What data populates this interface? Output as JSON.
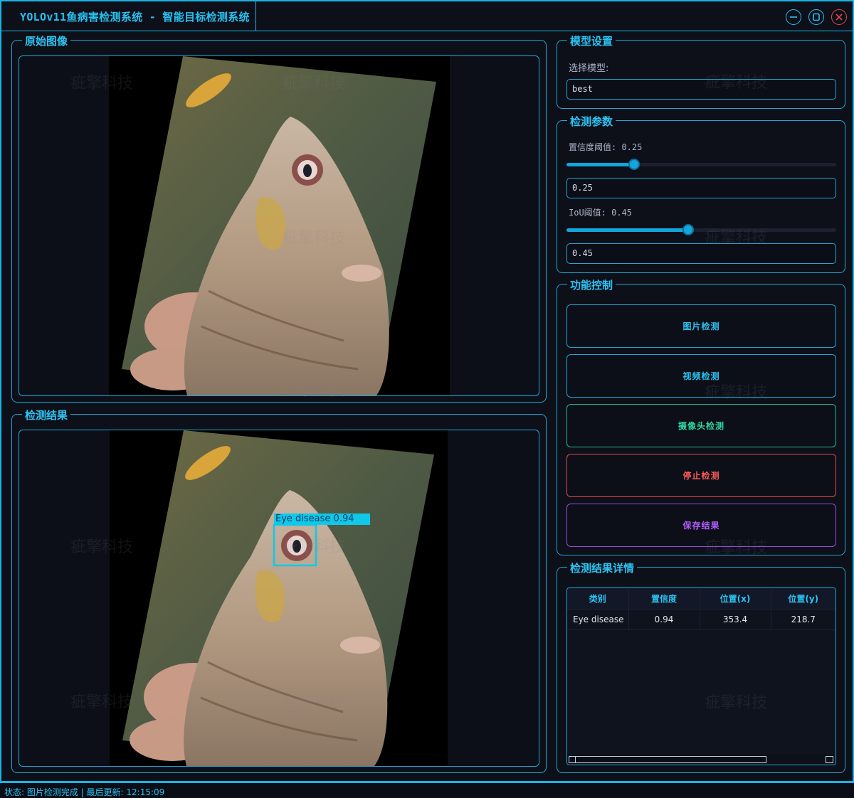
{
  "window": {
    "title": "YOLOv11鱼病害检测系统 - 智能目标检测系统"
  },
  "watermark": "疵擎科技",
  "original_panel": {
    "title": "原始图像"
  },
  "result_panel": {
    "title": "检测结果",
    "detection_label": "Eye disease 0.94"
  },
  "model_settings": {
    "title": "模型设置",
    "select_label": "选择模型:",
    "selected_model": "best"
  },
  "detection_params": {
    "title": "检测参数",
    "confidence_label": "置信度阈值: 0.25",
    "confidence_value": "0.25",
    "confidence": 0.25,
    "iou_label": "IoU阈值: 0.45",
    "iou_value": "0.45",
    "iou": 0.45
  },
  "controls": {
    "title": "功能控制",
    "image_detect": "图片检测",
    "video_detect": "视频检测",
    "camera_detect": "摄像头检测",
    "stop_detect": "停止检测",
    "save_result": "保存结果",
    "colors": {
      "image": "#2cc4f4",
      "video": "#2cc4f4",
      "camera": "#2fd6a0",
      "stop": "#ff5a5a",
      "save": "#b45cff"
    }
  },
  "results_detail": {
    "title": "检测结果详情",
    "columns": [
      "类别",
      "置信度",
      "位置(x)",
      "位置(y)"
    ],
    "rows": [
      [
        "Eye disease",
        "0.94",
        "353.4",
        "218.7"
      ]
    ]
  },
  "status_bar": {
    "text": "状态: 图片检测完成 | 最后更新: 12:15:09"
  },
  "icons": {
    "minimize": "minimize-icon",
    "maximize": "maximize-icon",
    "close": "close-icon"
  }
}
